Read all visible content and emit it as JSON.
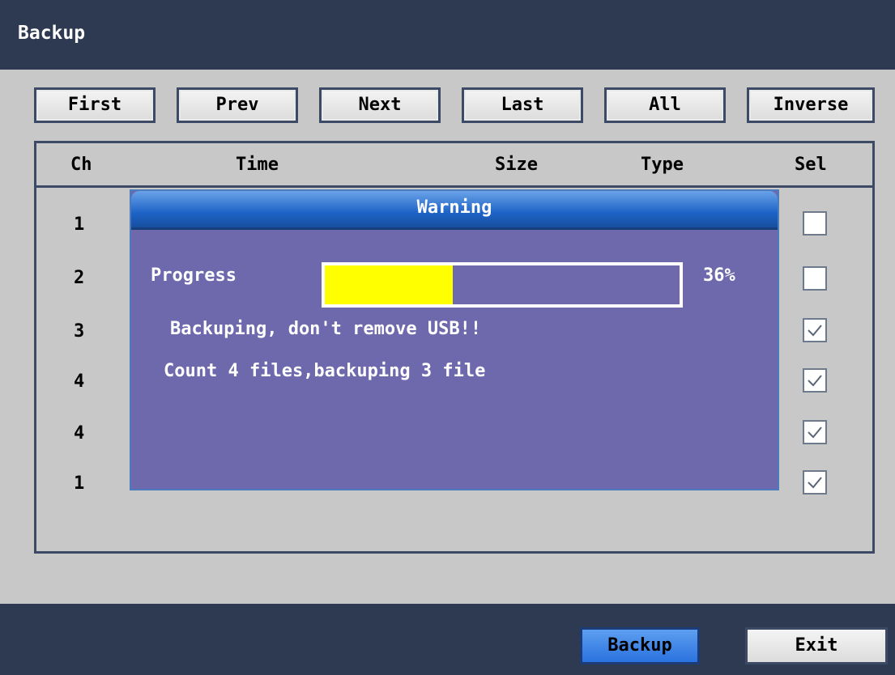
{
  "window": {
    "title": "Backup"
  },
  "toolbar": {
    "first": "First",
    "prev": "Prev",
    "next": "Next",
    "last": "Last",
    "all": "All",
    "inverse": "Inverse"
  },
  "table": {
    "headers": {
      "ch": "Ch",
      "time": "Time",
      "size": "Size",
      "type": "Type",
      "sel": "Sel"
    },
    "rows": [
      {
        "ch": "1",
        "selected": false
      },
      {
        "ch": "2",
        "selected": false
      },
      {
        "ch": "3",
        "selected": true
      },
      {
        "ch": "4",
        "selected": true
      },
      {
        "ch": "4",
        "selected": true
      },
      {
        "ch": "1",
        "selected": true
      }
    ]
  },
  "dialog": {
    "title": "Warning",
    "progress_label": "Progress",
    "progress_percent_text": "36%",
    "progress_value": 0.36,
    "message1": "Backuping, don't remove USB!!",
    "message2": "Count 4 files,backuping 3 file"
  },
  "footer": {
    "backup_label": "Backup",
    "exit_label": "Exit"
  },
  "colors": {
    "title_bar": "#2d3a52",
    "dialog_bg": "#6e68ad",
    "progress_fill": "#ffff00",
    "accent_button": "#2a72df"
  }
}
